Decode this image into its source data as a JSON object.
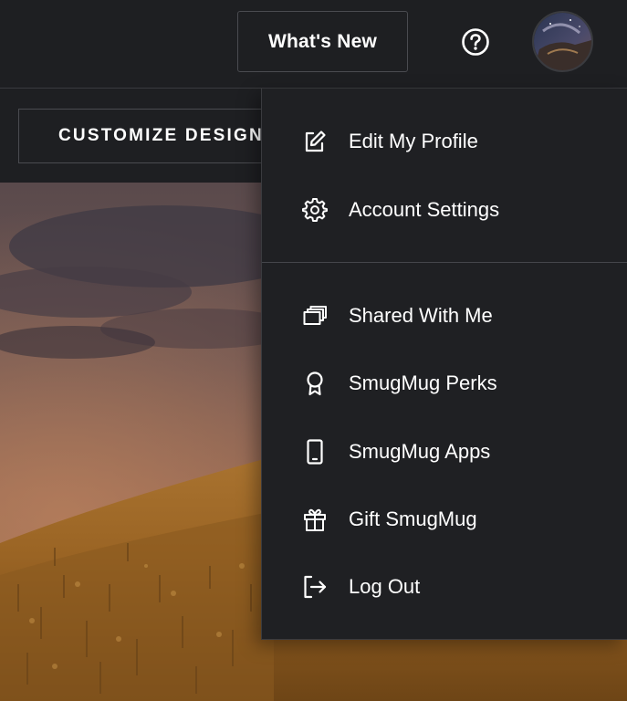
{
  "header": {
    "whats_new_label": "What's New",
    "help_icon": "help-circle-icon",
    "avatar_icon": "user-avatar"
  },
  "toolbar": {
    "customize_label": "CUSTOMIZE DESIGN"
  },
  "account_menu": {
    "items": [
      {
        "label": "Edit My Profile",
        "icon": "edit-icon"
      },
      {
        "label": "Account Settings",
        "icon": "gear-icon"
      },
      {
        "label": "Shared With Me",
        "icon": "shared-galleries-icon"
      },
      {
        "label": "SmugMug Perks",
        "icon": "award-ribbon-icon"
      },
      {
        "label": "SmugMug Apps",
        "icon": "phone-icon"
      },
      {
        "label": "Gift SmugMug",
        "icon": "gift-icon"
      },
      {
        "label": "Log Out",
        "icon": "log-out-icon"
      }
    ]
  },
  "colors": {
    "background": "#1e1f22",
    "menu_background": "#1f2023",
    "border": "#3a3b3f",
    "text": "#ffffff"
  }
}
